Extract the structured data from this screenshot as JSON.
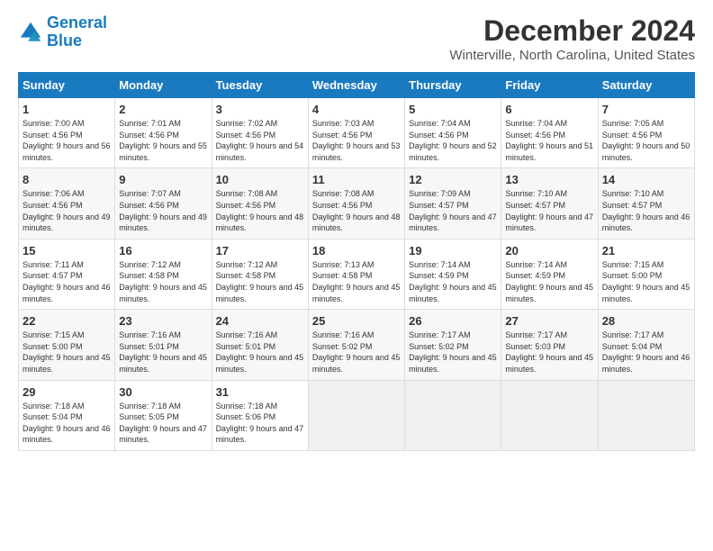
{
  "header": {
    "logo_line1": "General",
    "logo_line2": "Blue",
    "title": "December 2024",
    "subtitle": "Winterville, North Carolina, United States"
  },
  "weekdays": [
    "Sunday",
    "Monday",
    "Tuesday",
    "Wednesday",
    "Thursday",
    "Friday",
    "Saturday"
  ],
  "weeks": [
    [
      {
        "day": "1",
        "sunrise": "7:00 AM",
        "sunset": "4:56 PM",
        "daylight": "9 hours and 56 minutes."
      },
      {
        "day": "2",
        "sunrise": "7:01 AM",
        "sunset": "4:56 PM",
        "daylight": "9 hours and 55 minutes."
      },
      {
        "day": "3",
        "sunrise": "7:02 AM",
        "sunset": "4:56 PM",
        "daylight": "9 hours and 54 minutes."
      },
      {
        "day": "4",
        "sunrise": "7:03 AM",
        "sunset": "4:56 PM",
        "daylight": "9 hours and 53 minutes."
      },
      {
        "day": "5",
        "sunrise": "7:04 AM",
        "sunset": "4:56 PM",
        "daylight": "9 hours and 52 minutes."
      },
      {
        "day": "6",
        "sunrise": "7:04 AM",
        "sunset": "4:56 PM",
        "daylight": "9 hours and 51 minutes."
      },
      {
        "day": "7",
        "sunrise": "7:05 AM",
        "sunset": "4:56 PM",
        "daylight": "9 hours and 50 minutes."
      }
    ],
    [
      {
        "day": "8",
        "sunrise": "7:06 AM",
        "sunset": "4:56 PM",
        "daylight": "9 hours and 49 minutes."
      },
      {
        "day": "9",
        "sunrise": "7:07 AM",
        "sunset": "4:56 PM",
        "daylight": "9 hours and 49 minutes."
      },
      {
        "day": "10",
        "sunrise": "7:08 AM",
        "sunset": "4:56 PM",
        "daylight": "9 hours and 48 minutes."
      },
      {
        "day": "11",
        "sunrise": "7:08 AM",
        "sunset": "4:56 PM",
        "daylight": "9 hours and 48 minutes."
      },
      {
        "day": "12",
        "sunrise": "7:09 AM",
        "sunset": "4:57 PM",
        "daylight": "9 hours and 47 minutes."
      },
      {
        "day": "13",
        "sunrise": "7:10 AM",
        "sunset": "4:57 PM",
        "daylight": "9 hours and 47 minutes."
      },
      {
        "day": "14",
        "sunrise": "7:10 AM",
        "sunset": "4:57 PM",
        "daylight": "9 hours and 46 minutes."
      }
    ],
    [
      {
        "day": "15",
        "sunrise": "7:11 AM",
        "sunset": "4:57 PM",
        "daylight": "9 hours and 46 minutes."
      },
      {
        "day": "16",
        "sunrise": "7:12 AM",
        "sunset": "4:58 PM",
        "daylight": "9 hours and 45 minutes."
      },
      {
        "day": "17",
        "sunrise": "7:12 AM",
        "sunset": "4:58 PM",
        "daylight": "9 hours and 45 minutes."
      },
      {
        "day": "18",
        "sunrise": "7:13 AM",
        "sunset": "4:58 PM",
        "daylight": "9 hours and 45 minutes."
      },
      {
        "day": "19",
        "sunrise": "7:14 AM",
        "sunset": "4:59 PM",
        "daylight": "9 hours and 45 minutes."
      },
      {
        "day": "20",
        "sunrise": "7:14 AM",
        "sunset": "4:59 PM",
        "daylight": "9 hours and 45 minutes."
      },
      {
        "day": "21",
        "sunrise": "7:15 AM",
        "sunset": "5:00 PM",
        "daylight": "9 hours and 45 minutes."
      }
    ],
    [
      {
        "day": "22",
        "sunrise": "7:15 AM",
        "sunset": "5:00 PM",
        "daylight": "9 hours and 45 minutes."
      },
      {
        "day": "23",
        "sunrise": "7:16 AM",
        "sunset": "5:01 PM",
        "daylight": "9 hours and 45 minutes."
      },
      {
        "day": "24",
        "sunrise": "7:16 AM",
        "sunset": "5:01 PM",
        "daylight": "9 hours and 45 minutes."
      },
      {
        "day": "25",
        "sunrise": "7:16 AM",
        "sunset": "5:02 PM",
        "daylight": "9 hours and 45 minutes."
      },
      {
        "day": "26",
        "sunrise": "7:17 AM",
        "sunset": "5:02 PM",
        "daylight": "9 hours and 45 minutes."
      },
      {
        "day": "27",
        "sunrise": "7:17 AM",
        "sunset": "5:03 PM",
        "daylight": "9 hours and 45 minutes."
      },
      {
        "day": "28",
        "sunrise": "7:17 AM",
        "sunset": "5:04 PM",
        "daylight": "9 hours and 46 minutes."
      }
    ],
    [
      {
        "day": "29",
        "sunrise": "7:18 AM",
        "sunset": "5:04 PM",
        "daylight": "9 hours and 46 minutes."
      },
      {
        "day": "30",
        "sunrise": "7:18 AM",
        "sunset": "5:05 PM",
        "daylight": "9 hours and 47 minutes."
      },
      {
        "day": "31",
        "sunrise": "7:18 AM",
        "sunset": "5:06 PM",
        "daylight": "9 hours and 47 minutes."
      },
      null,
      null,
      null,
      null
    ]
  ]
}
